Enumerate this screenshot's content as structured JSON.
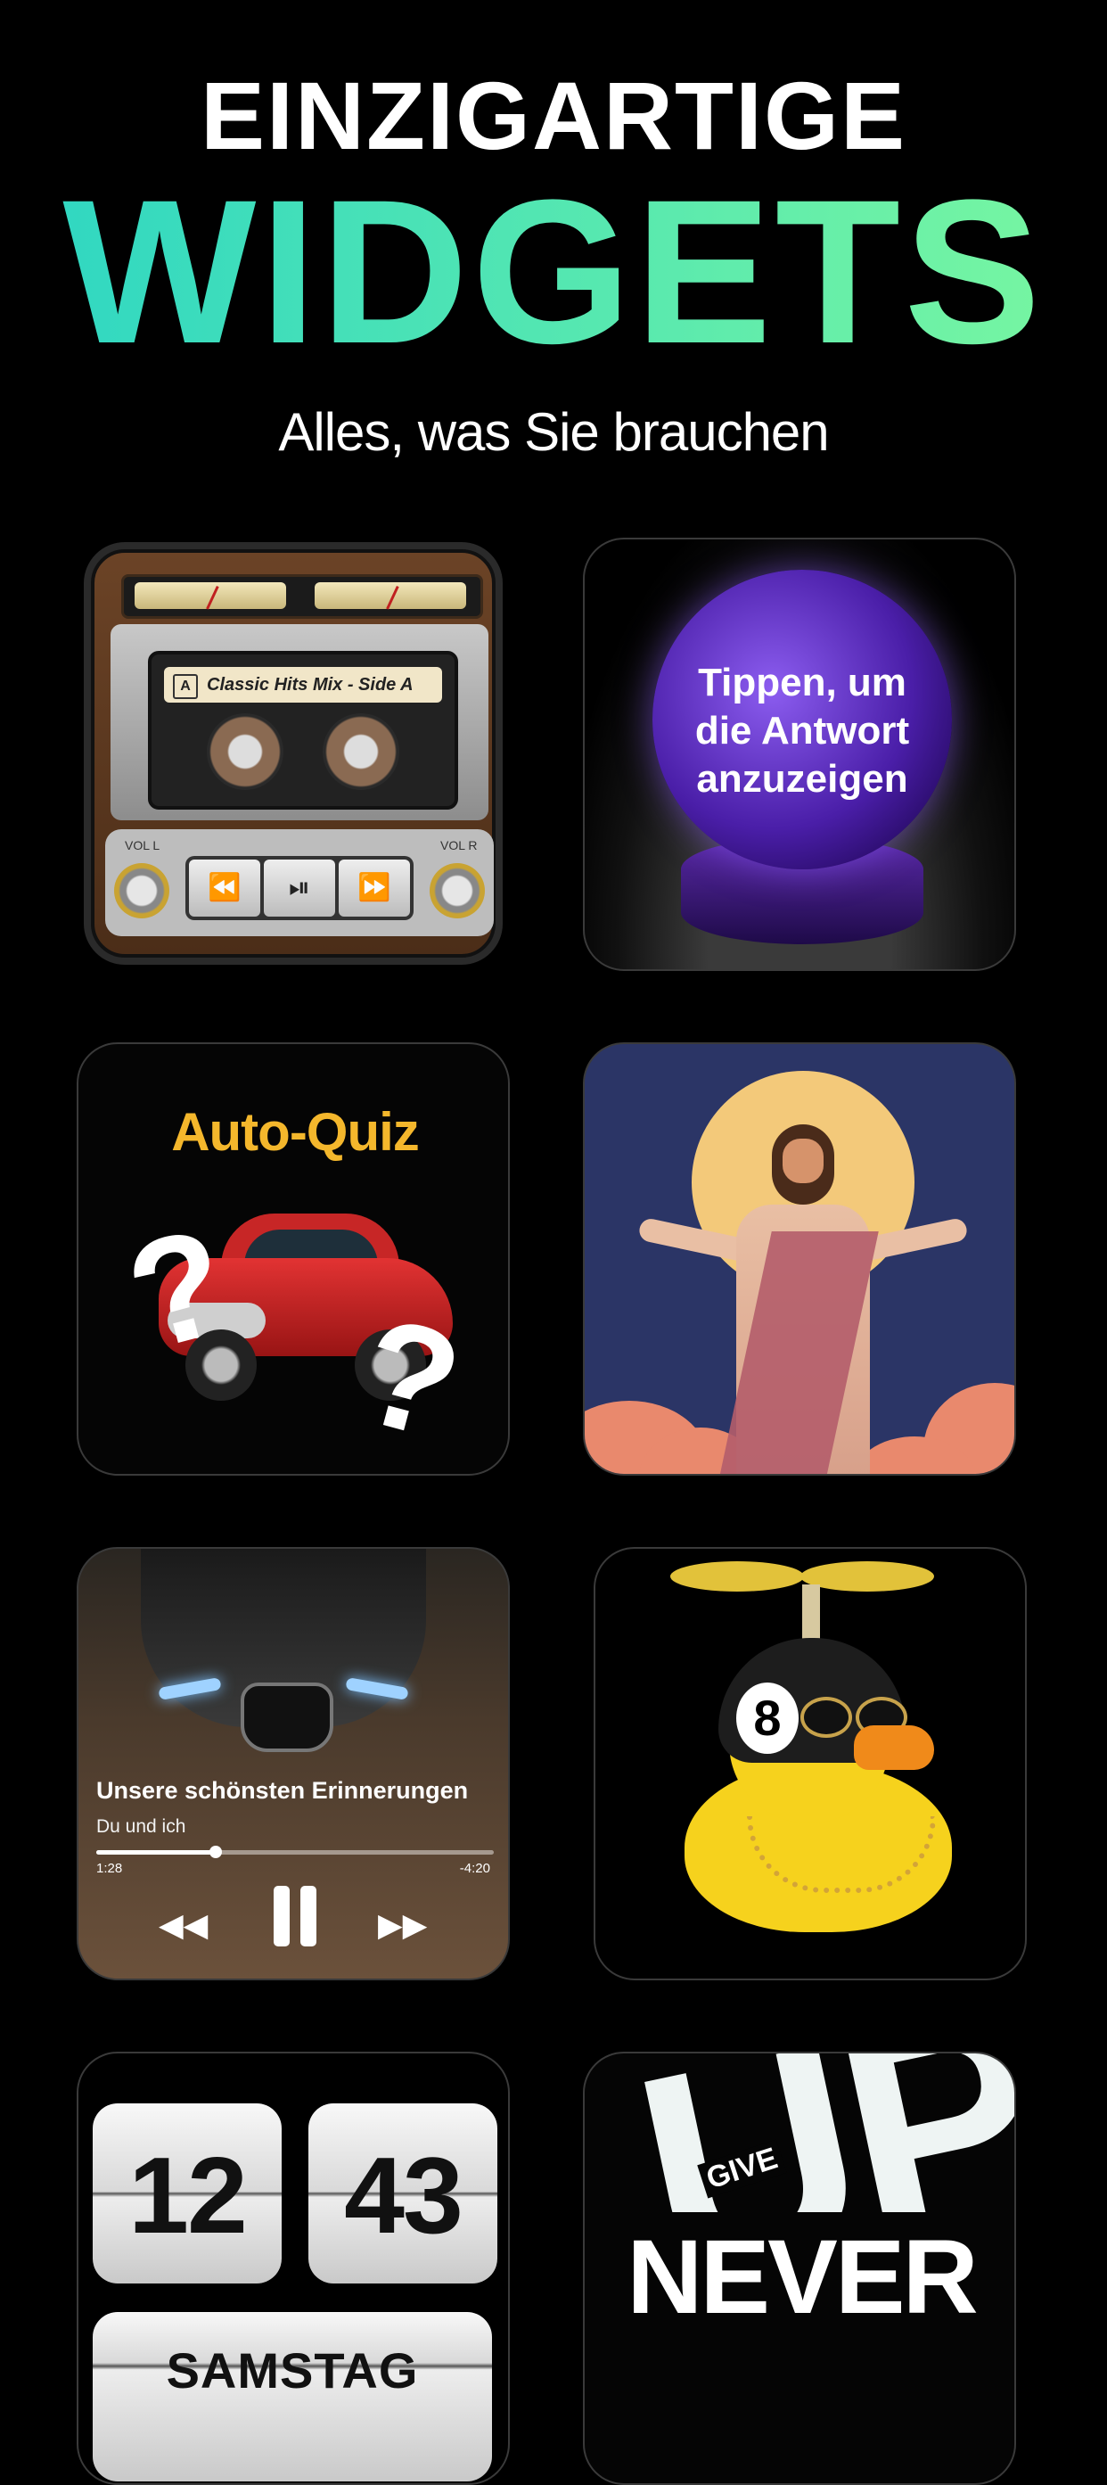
{
  "hero": {
    "line1": "EINZIGARTIGE",
    "line2": "WIDGETS",
    "subtitle": "Alles, was Sie brauchen"
  },
  "cassette": {
    "label_side": "A",
    "label": "Classic Hits Mix - Side A",
    "vu_left": "VU",
    "vu_right": "VU",
    "vol_l": "VOL L",
    "vol_r": "VOL R",
    "rewind_icon": "⏪",
    "playpause_icon": "⏯",
    "forward_icon": "⏩"
  },
  "crystal_ball": {
    "line1": "Tippen, um",
    "line2": "die Antwort",
    "line3": "anzuzeigen"
  },
  "quiz": {
    "title": "Auto-Quiz",
    "mark": "?"
  },
  "music": {
    "title": "Unsere schönsten Erinnerungen",
    "artist": "Du und ich",
    "elapsed": "1:28",
    "remaining": "-4:20",
    "progress": 0.3,
    "rewind_icon": "◀◀",
    "forward_icon": "▶▶"
  },
  "duck": {
    "ball_number": "8"
  },
  "clock": {
    "hour": "12",
    "minute": "43",
    "day": "SAMSTAG"
  },
  "motivation": {
    "give": "GIVE",
    "never": "NEVER",
    "up": "UP"
  },
  "colors": {
    "gradient_start": "#2dd6c3",
    "gradient_end": "#7af7a0",
    "quiz_title": "#f4b72c"
  }
}
